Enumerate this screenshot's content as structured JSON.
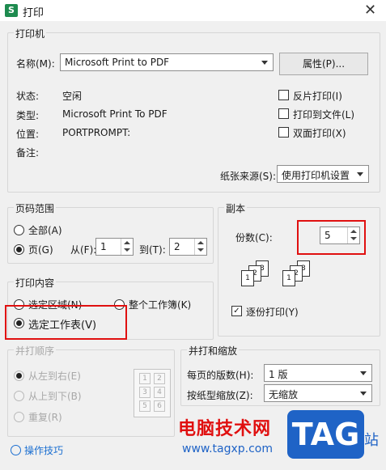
{
  "window": {
    "title": "打印",
    "app_icon": "S"
  },
  "printer": {
    "group_label": "打印机",
    "name_label": "名称(M):",
    "name_value": "Microsoft Print to PDF",
    "properties_button": "属性(P)...",
    "status_label": "状态:",
    "status_value": "空闲",
    "type_label": "类型:",
    "type_value": "Microsoft Print To PDF",
    "location_label": "位置:",
    "location_value": "PORTPROMPT:",
    "comment_label": "备注:",
    "reverse_print": "反片打印(I)",
    "print_to_file": "打印到文件(L)",
    "duplex": "双面打印(X)",
    "paper_source_label": "纸张来源(S):",
    "paper_source_value": "使用打印机设置"
  },
  "page_range": {
    "group_label": "页码范围",
    "all_label": "全部(A)",
    "pages_label": "页(G)",
    "from_label": "从(F):",
    "from_value": "1",
    "to_label": "到(T):",
    "to_value": "2"
  },
  "copies": {
    "group_label": "副本",
    "count_label": "份数(C):",
    "count_value": "5",
    "collate_label": "逐份打印(Y)"
  },
  "print_content": {
    "group_label": "打印内容",
    "selection_label": "选定区域(N)",
    "whole_workbook_label": "整个工作簿(K)",
    "selected_sheet_label": "选定工作表(V)"
  },
  "print_order": {
    "group_label": "并打顺序",
    "left_to_right": "从左到右(E)",
    "top_to_bottom": "从上到下(B)",
    "repeat": "重复(R)",
    "grid_numbers": [
      "1",
      "2",
      "3",
      "4",
      "5",
      "6"
    ]
  },
  "merge_scale": {
    "group_label": "并打和缩放",
    "pages_per_sheet_label": "每页的版数(H):",
    "pages_per_sheet_value": "1 版",
    "scale_label": "按纸型缩放(Z):",
    "scale_value": "无缩放"
  },
  "footer": {
    "tips_label": "操作技巧"
  },
  "watermark": {
    "site_name": "电脑技术网",
    "url": "www.tagxp.com",
    "tag": "TAG",
    "suffix": "站"
  },
  "colors": {
    "highlight": "#e01010",
    "tag_blue": "#1f63c6"
  }
}
